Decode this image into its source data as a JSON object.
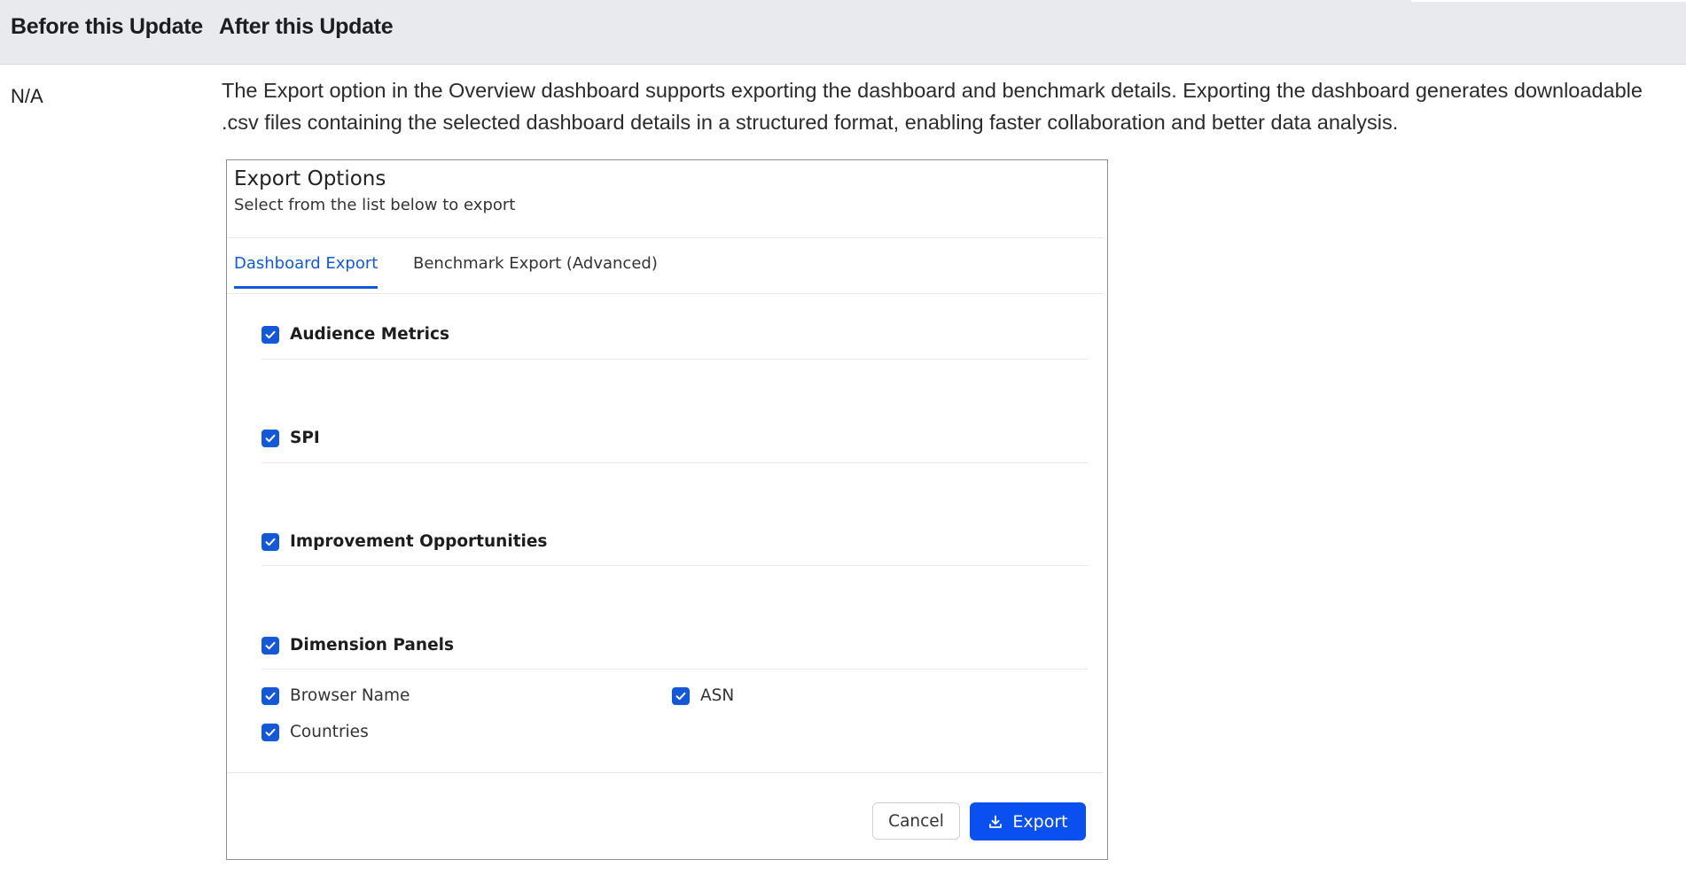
{
  "table": {
    "headers": [
      "Before this Update",
      "After this Update"
    ],
    "before_value": "N/A",
    "after_description": "The Export option in the Overview dashboard supports exporting the dashboard and benchmark details. Exporting the dashboard generates downloadable .csv files containing the selected dashboard details in a structured format, enabling faster collaboration and better data analysis."
  },
  "dialog": {
    "title": "Export Options",
    "subtitle": "Select from the list below to export",
    "tabs": [
      {
        "label": "Dashboard Export",
        "active": true
      },
      {
        "label": "Benchmark Export (Advanced)",
        "active": false
      }
    ],
    "sections": [
      {
        "label": "Audience Metrics",
        "checked": true
      },
      {
        "label": "SPI",
        "checked": true
      },
      {
        "label": "Improvement Opportunities",
        "checked": true
      },
      {
        "label": "Dimension Panels",
        "checked": true
      }
    ],
    "dimension_items": [
      {
        "label": "Browser Name",
        "checked": true
      },
      {
        "label": "ASN",
        "checked": true
      },
      {
        "label": "Countries",
        "checked": true
      }
    ],
    "buttons": {
      "cancel": "Cancel",
      "export": "Export"
    }
  },
  "colors": {
    "accent": "#1458d8",
    "export_button": "#0a4ff0",
    "header_bg": "#e8eaee"
  },
  "icons": {
    "checkbox": "check-icon",
    "export": "download-icon"
  }
}
